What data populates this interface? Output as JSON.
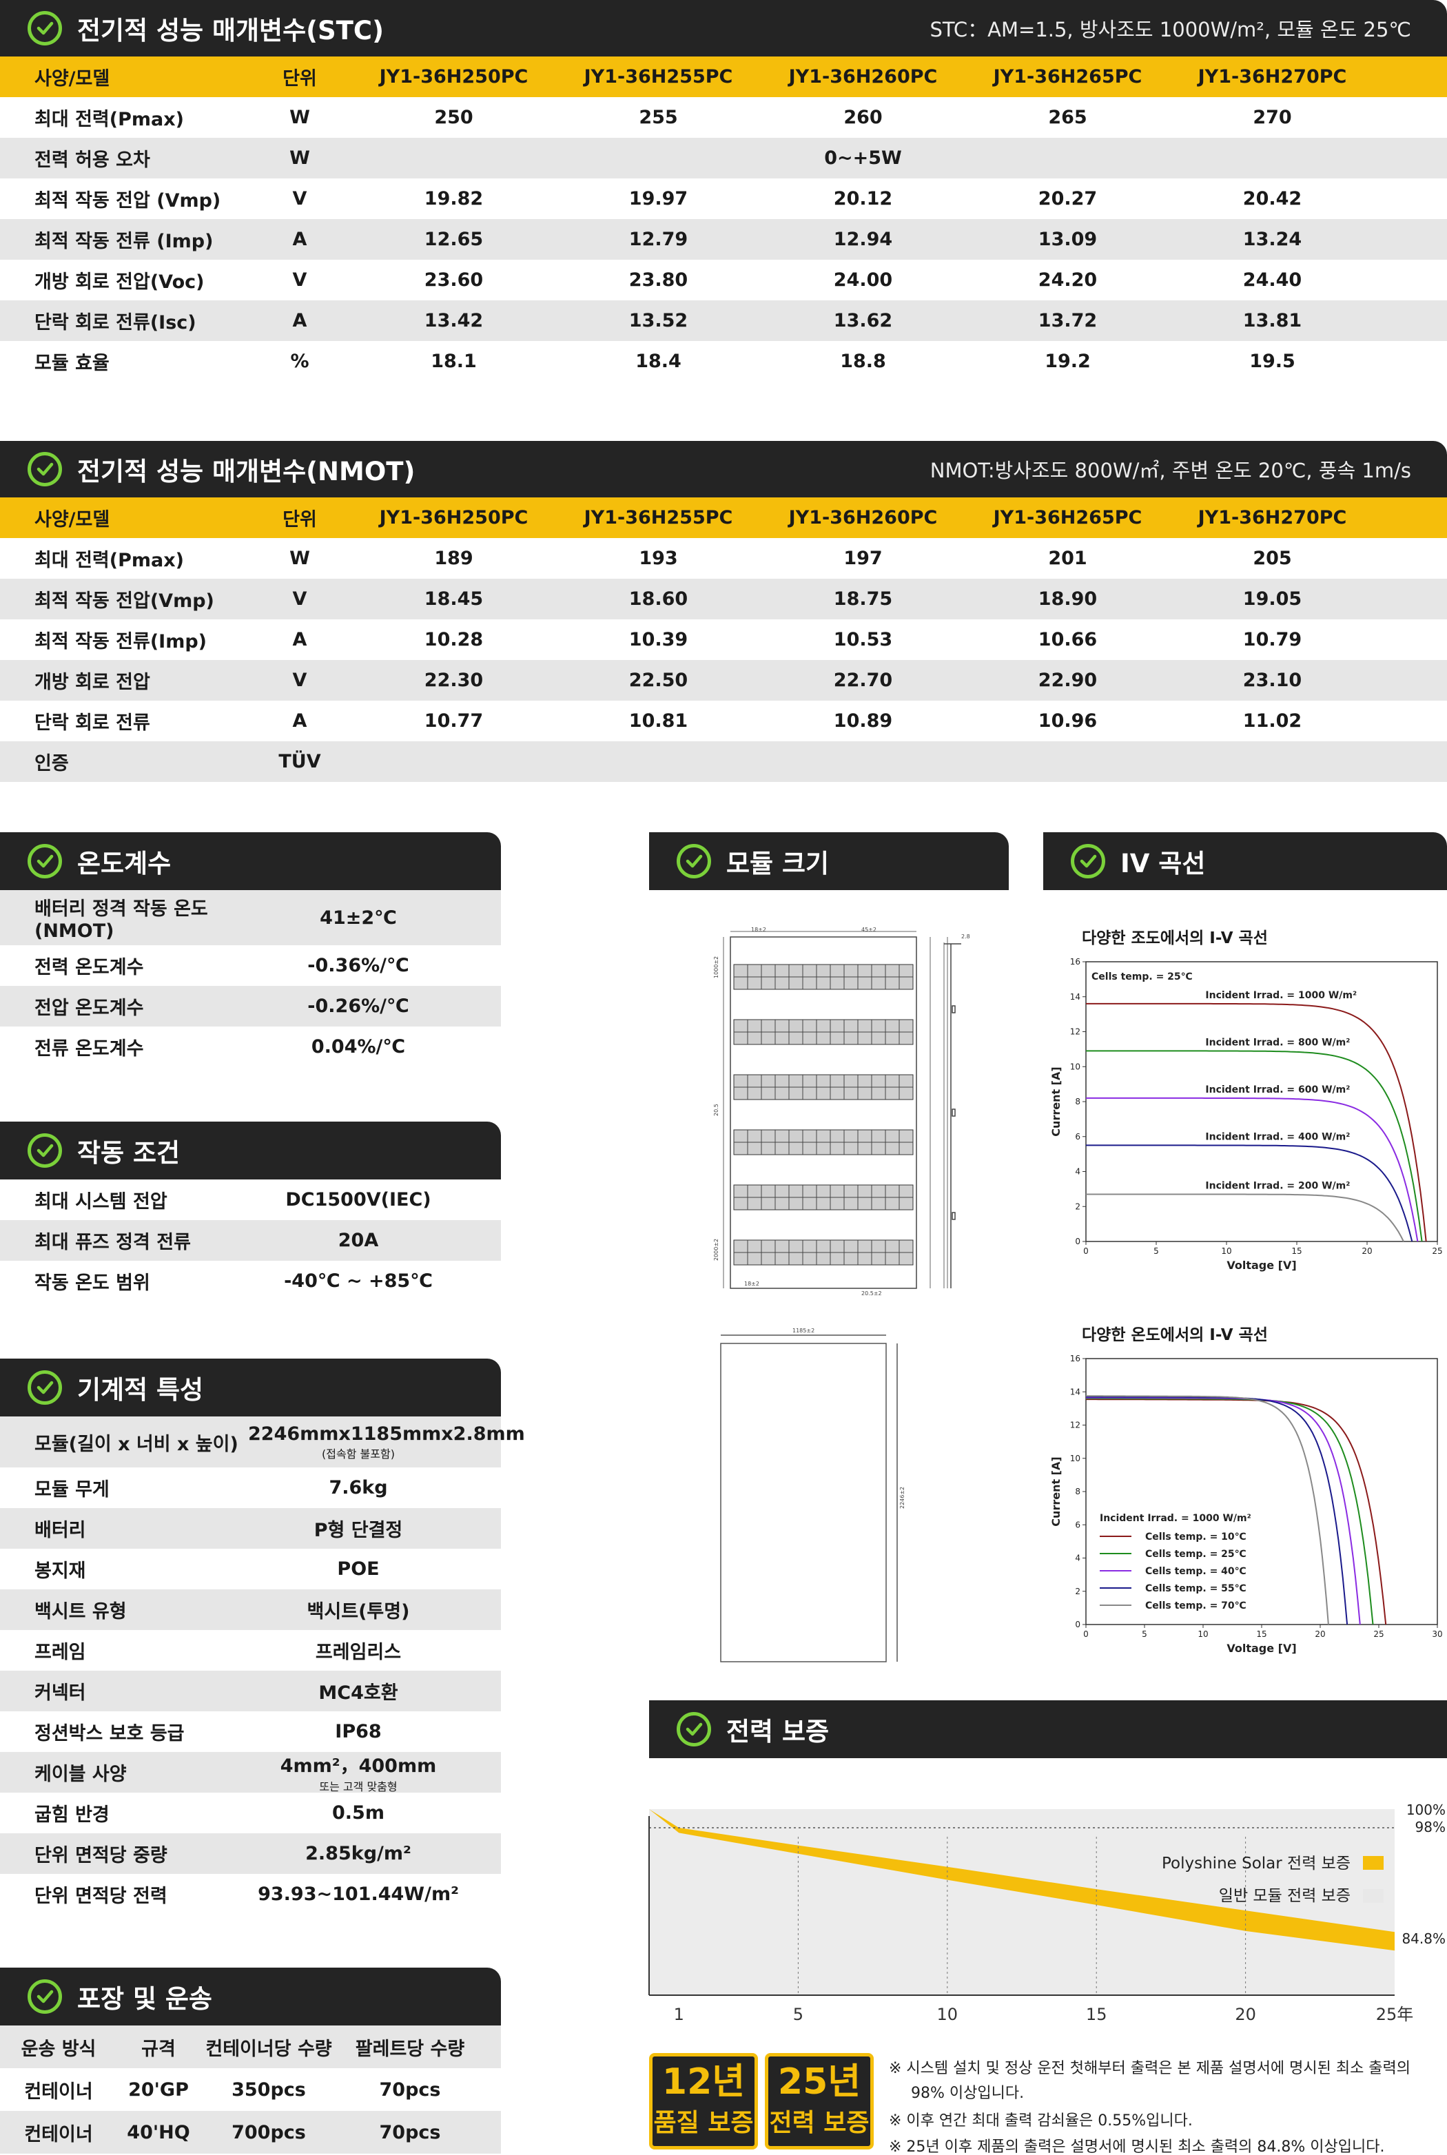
{
  "stc": {
    "title": "전기적 성능 매개변수(STC)",
    "note": "STC：AM=1.5, 방사조도 1000W/m², 모듈 온도 25℃",
    "header": [
      "사양/모델",
      "단위",
      "JY1-36H250PC",
      "JY1-36H255PC",
      "JY1-36H260PC",
      "JY1-36H265PC",
      "JY1-36H270PC"
    ],
    "rows": [
      [
        "최대 전력(Pmax)",
        "W",
        "250",
        "255",
        "260",
        "265",
        "270"
      ],
      [
        "전력 허용 오차",
        "W",
        "",
        "",
        "0~+5W",
        "",
        ""
      ],
      [
        "최적 작동 전압 (Vmp)",
        "V",
        "19.82",
        "19.97",
        "20.12",
        "20.27",
        "20.42"
      ],
      [
        "최적 작동 전류 (Imp)",
        "A",
        "12.65",
        "12.79",
        "12.94",
        "13.09",
        "13.24"
      ],
      [
        "개방 회로 전압(Voc)",
        "V",
        "23.60",
        "23.80",
        "24.00",
        "24.20",
        "24.40"
      ],
      [
        "단락 회로 전류(Isc)",
        "A",
        "13.42",
        "13.52",
        "13.62",
        "13.72",
        "13.81"
      ],
      [
        "모듈 효율",
        "%",
        "18.1",
        "18.4",
        "18.8",
        "19.2",
        "19.5"
      ]
    ]
  },
  "nmot": {
    "title": "전기적 성능 매개변수(NMOT)",
    "note": "NMOT:방사조도 800W/㎡, 주변 온도 20℃, 풍속 1m/s",
    "header": [
      "사양/모델",
      "단위",
      "JY1-36H250PC",
      "JY1-36H255PC",
      "JY1-36H260PC",
      "JY1-36H265PC",
      "JY1-36H270PC"
    ],
    "rows": [
      [
        "최대 전력(Pmax)",
        "W",
        "189",
        "193",
        "197",
        "201",
        "205"
      ],
      [
        "최적 작동 전압(Vmp)",
        "V",
        "18.45",
        "18.60",
        "18.75",
        "18.90",
        "19.05"
      ],
      [
        "최적 작동 전류(Imp)",
        "A",
        "10.28",
        "10.39",
        "10.53",
        "10.66",
        "10.79"
      ],
      [
        "개방 회로 전압",
        "V",
        "22.30",
        "22.50",
        "22.70",
        "22.90",
        "23.10"
      ],
      [
        "단락 회로 전류",
        "A",
        "10.77",
        "10.81",
        "10.89",
        "10.96",
        "11.02"
      ],
      [
        "인증",
        "TÜV",
        "",
        "",
        "",
        "",
        ""
      ]
    ]
  },
  "temp": {
    "title": "온도계수",
    "rows": [
      [
        "배터리 정격 작동 온도(NMOT)",
        "41±2℃"
      ],
      [
        "전력 온도계수",
        "-0.36%/℃"
      ],
      [
        "전압 온도계수",
        "-0.26%/℃"
      ],
      [
        "전류 온도계수",
        "0.04%/℃"
      ]
    ]
  },
  "operation": {
    "title": "작동 조건",
    "rows": [
      [
        "최대 시스템 전압",
        "DC1500V(IEC)"
      ],
      [
        "최대 퓨즈 정격 전류",
        "20A"
      ],
      [
        "작동 온도 범위",
        "-40℃ ~ +85℃"
      ]
    ]
  },
  "mechanical": {
    "title": "기계적 특성",
    "rows": [
      [
        "모듈(길이 x 너비 x 높이)",
        "2246mmx1185mmx2.8mm",
        "(접속함 불포함)"
      ],
      [
        "모듈 무게",
        "7.6kg",
        ""
      ],
      [
        "배터리",
        "P형 단결정",
        ""
      ],
      [
        "봉지재",
        "POE",
        ""
      ],
      [
        "백시트 유형",
        "백시트(투명)",
        ""
      ],
      [
        "프레임",
        "프레임리스",
        ""
      ],
      [
        "커넥터",
        "MC4호환",
        ""
      ],
      [
        "정션박스 보호 등급",
        "IP68",
        ""
      ],
      [
        "케이블 사양",
        "4mm²，400mm",
        "또는 고객 맞춤형"
      ],
      [
        "굽힘 반경",
        "0.5m",
        ""
      ],
      [
        "단위 면적당 중량",
        "2.85kg/m²",
        ""
      ],
      [
        "단위 면적당 전력",
        "93.93~101.44W/m²",
        ""
      ]
    ]
  },
  "packing": {
    "title": "포장 및 운송",
    "header": [
      "운송 방식",
      "규격",
      "컨테이너당 수량",
      "팔레트당 수량"
    ],
    "rows": [
      [
        "컨테이너",
        "20'GP",
        "350pcs",
        "70pcs"
      ],
      [
        "컨테이너",
        "40'HQ",
        "700pcs",
        "70pcs"
      ]
    ]
  },
  "module_size": {
    "title": "모듈 크기",
    "dims": [
      "18±2",
      "45±2",
      "2.8",
      "1000±2",
      "20.5",
      "2000±2",
      "18±2",
      "20.5±2",
      "1185±2",
      "2246±2"
    ]
  },
  "iv": {
    "title": "IV 곡선",
    "chart1_title": "다양한 조도에서의 I-V 곡선",
    "chart2_title": "다양한 온도에서의 I-V 곡선"
  },
  "chart_data": [
    {
      "type": "line",
      "title": "다양한 조도에서의 I-V 곡선",
      "xlabel": "Voltage [V]",
      "ylabel": "Current [A]",
      "xlim": [
        0,
        25
      ],
      "ylim": [
        0,
        16
      ],
      "xticks": [
        0,
        5,
        10,
        15,
        20,
        25
      ],
      "yticks": [
        0,
        2,
        4,
        6,
        8,
        10,
        12,
        14,
        16
      ],
      "annotation": "Cells temp. = 25℃",
      "series": [
        {
          "name": "Incident Irrad. = 1000 W/m²",
          "color": "#8b1a1a",
          "isc": 13.6,
          "voc": 24.2
        },
        {
          "name": "Incident Irrad. = 800 W/m²",
          "color": "#1e8c1e",
          "isc": 10.9,
          "voc": 23.9
        },
        {
          "name": "Incident Irrad. = 600 W/m²",
          "color": "#8a2be2",
          "isc": 8.2,
          "voc": 23.6
        },
        {
          "name": "Incident Irrad. = 400 W/m²",
          "color": "#1a1a8b",
          "isc": 5.5,
          "voc": 23.2
        },
        {
          "name": "Incident Irrad. = 200 W/m²",
          "color": "#888888",
          "isc": 2.7,
          "voc": 22.6
        }
      ]
    },
    {
      "type": "line",
      "title": "다양한 온도에서의 I-V 곡선",
      "xlabel": "Voltage [V]",
      "ylabel": "Current [A]",
      "xlim": [
        0,
        30
      ],
      "ylim": [
        0,
        16
      ],
      "xticks": [
        0,
        5,
        10,
        15,
        20,
        25,
        30
      ],
      "yticks": [
        0,
        2,
        4,
        6,
        8,
        10,
        12,
        14,
        16
      ],
      "annotation": "Incident Irrad. = 1000 W/m²",
      "series": [
        {
          "name": "Cells temp. = 10℃",
          "color": "#8b1a1a",
          "isc": 13.55,
          "voc": 25.6
        },
        {
          "name": "Cells temp. = 25℃",
          "color": "#1e8c1e",
          "isc": 13.6,
          "voc": 24.5
        },
        {
          "name": "Cells temp. = 40℃",
          "color": "#8a2be2",
          "isc": 13.65,
          "voc": 23.4
        },
        {
          "name": "Cells temp. = 55℃",
          "color": "#1a1a8b",
          "isc": 13.7,
          "voc": 22.3
        },
        {
          "name": "Cells temp. = 70℃",
          "color": "#888888",
          "isc": 13.75,
          "voc": 20.7
        }
      ]
    },
    {
      "type": "area",
      "title": "전력 보증",
      "x": [
        0,
        1,
        5,
        10,
        15,
        20,
        25
      ],
      "xticks": [
        "1",
        "5",
        "10",
        "15",
        "20",
        "25年"
      ],
      "ylim": [
        80,
        100
      ],
      "yticks": [
        "100%",
        "98%",
        "84.8%"
      ],
      "series": [
        {
          "name": "Polyshine Solar 전력 보증",
          "color": "#f5be0b",
          "upper": [
            100,
            98,
            96.1,
            93.8,
            91.4,
            89.1,
            86.8
          ],
          "lower": [
            100,
            97.45,
            95.2,
            92.4,
            89.7,
            86.9,
            84.8
          ]
        },
        {
          "name": "일반 모듈 전력 보증",
          "color": "#e8e8e8"
        }
      ]
    }
  ],
  "warranty": {
    "title": "전력 보증",
    "y_100": "100%",
    "y_98": "98%",
    "y_848": "84.8%",
    "legend1": "Polyshine Solar 전력 보증",
    "legend2": "일반 모듈 전력 보증",
    "xticks": [
      "1",
      "5",
      "10",
      "15",
      "20",
      "25年"
    ],
    "badge1_big": "12년",
    "badge1_small": "품질 보증",
    "badge2_big": "25년",
    "badge2_small": "전력 보증",
    "notes": [
      "※  시스템 설치 및 정상 운전 첫해부터 출력은 본 제품 설명서에 명시된 최소 출력의",
      "98% 이상입니다.",
      "※  이후 연간 최대 출력 감쇠율은 0.55%입니다.",
      "※  25년 이후 제품의 출력은 설명서에 명시된 최소 출력의 84.8% 이상입니다."
    ]
  }
}
